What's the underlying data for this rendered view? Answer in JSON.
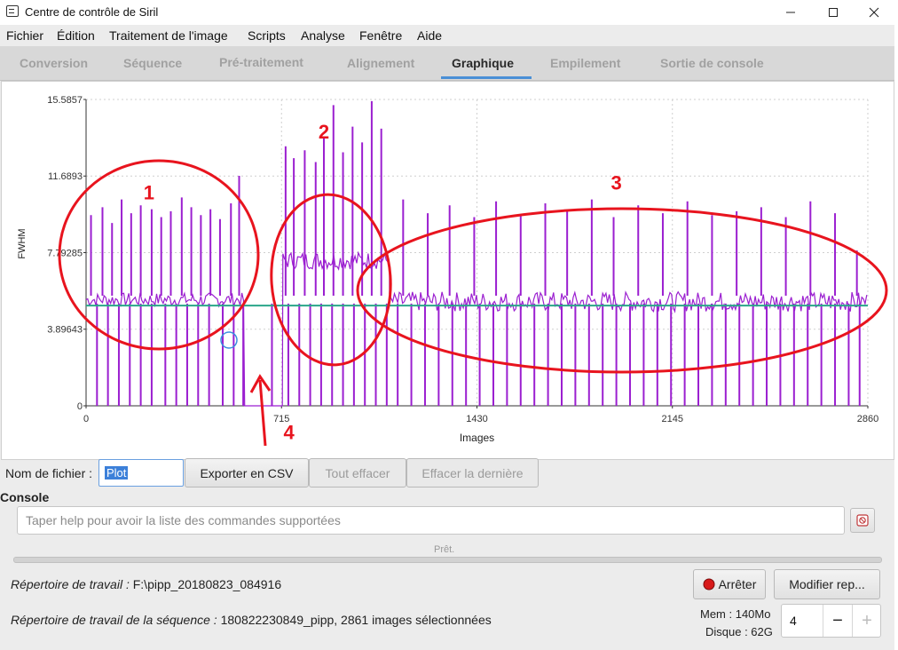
{
  "window": {
    "title": "Centre de contrôle de Siril",
    "app_icon": "siril-icon",
    "minimize_icon": "minimize-icon",
    "maximize_icon": "maximize-icon",
    "close_icon": "close-icon"
  },
  "menu": {
    "items": [
      {
        "label": "Fichier"
      },
      {
        "label": "Édition"
      },
      {
        "label": "Traitement de l'image"
      },
      {
        "label": "Scripts"
      },
      {
        "label": "Analyse"
      },
      {
        "label": "Fenêtre"
      },
      {
        "label": "Aide"
      }
    ]
  },
  "tabs": {
    "items": [
      {
        "label": "Conversion",
        "active": false
      },
      {
        "label": "Séquence",
        "active": false
      },
      {
        "label": "Pré-traitement",
        "active": false
      },
      {
        "label": "Alignement",
        "active": false
      },
      {
        "label": "Graphique",
        "active": true
      },
      {
        "label": "Empilement",
        "active": false
      },
      {
        "label": "Sortie de console",
        "active": false
      }
    ],
    "accent_color": "#4a8fd6"
  },
  "chart_data": {
    "type": "line",
    "title": "",
    "xlabel": "Images",
    "ylabel": "FWHM",
    "xlim": [
      0,
      2860
    ],
    "ylim": [
      0,
      15.5857
    ],
    "x_ticks": [
      "0",
      "715",
      "1430",
      "2145",
      "2860"
    ],
    "y_ticks": [
      "0",
      "3.89643",
      "7.79285",
      "11.6893",
      "15.5857"
    ],
    "grid": true,
    "series": [
      {
        "color": "#9b1fd0",
        "segments": [
          {
            "x_range": [
              0,
              580
            ],
            "base": 5.4,
            "noise": 0.35
          },
          {
            "x_range": [
              580,
              720
            ],
            "base": 0.0,
            "noise": 0.0
          },
          {
            "x_range": [
              720,
              1110
            ],
            "base": 7.4,
            "noise": 0.45
          },
          {
            "x_range": [
              1110,
              2860
            ],
            "base": 5.3,
            "noise": 0.5
          }
        ],
        "spikes_up": [
          {
            "x": 18,
            "y": 9.7
          },
          {
            "x": 60,
            "y": 10.1
          },
          {
            "x": 95,
            "y": 9.3
          },
          {
            "x": 130,
            "y": 10.5
          },
          {
            "x": 165,
            "y": 9.8
          },
          {
            "x": 200,
            "y": 10.2
          },
          {
            "x": 240,
            "y": 10.0
          },
          {
            "x": 275,
            "y": 9.6
          },
          {
            "x": 310,
            "y": 9.9
          },
          {
            "x": 350,
            "y": 10.6
          },
          {
            "x": 385,
            "y": 10.1
          },
          {
            "x": 420,
            "y": 9.7
          },
          {
            "x": 455,
            "y": 10.0
          },
          {
            "x": 490,
            "y": 9.5
          },
          {
            "x": 530,
            "y": 10.3
          },
          {
            "x": 560,
            "y": 11.7
          },
          {
            "x": 730,
            "y": 13.2
          },
          {
            "x": 760,
            "y": 12.6
          },
          {
            "x": 800,
            "y": 13.0
          },
          {
            "x": 840,
            "y": 12.4
          },
          {
            "x": 870,
            "y": 13.6
          },
          {
            "x": 905,
            "y": 15.3
          },
          {
            "x": 940,
            "y": 12.9
          },
          {
            "x": 975,
            "y": 14.2
          },
          {
            "x": 1010,
            "y": 13.4
          },
          {
            "x": 1045,
            "y": 15.5
          },
          {
            "x": 1080,
            "y": 14.1
          },
          {
            "x": 1160,
            "y": 10.5
          },
          {
            "x": 1250,
            "y": 9.8
          },
          {
            "x": 1330,
            "y": 10.2
          },
          {
            "x": 1420,
            "y": 9.6
          },
          {
            "x": 1500,
            "y": 10.4
          },
          {
            "x": 1590,
            "y": 9.7
          },
          {
            "x": 1680,
            "y": 10.3
          },
          {
            "x": 1760,
            "y": 9.9
          },
          {
            "x": 1850,
            "y": 10.5
          },
          {
            "x": 1930,
            "y": 9.6
          },
          {
            "x": 2020,
            "y": 10.2
          },
          {
            "x": 2110,
            "y": 9.8
          },
          {
            "x": 2200,
            "y": 10.4
          },
          {
            "x": 2290,
            "y": 9.7
          },
          {
            "x": 2380,
            "y": 9.9
          },
          {
            "x": 2470,
            "y": 10.1
          },
          {
            "x": 2560,
            "y": 9.6
          },
          {
            "x": 2650,
            "y": 10.4
          },
          {
            "x": 2740,
            "y": 9.8
          },
          {
            "x": 2820,
            "y": 7.9
          }
        ],
        "drops_to_zero": [
          40,
          80,
          120,
          160,
          200,
          240,
          290,
          330,
          370,
          410,
          450,
          500,
          540,
          575,
          680,
          740,
          780,
          820,
          860,
          900,
          940,
          980,
          1020,
          1060,
          1100,
          1140,
          1190,
          1240,
          1290,
          1340,
          1390,
          1440,
          1490,
          1540,
          1590,
          1640,
          1690,
          1740,
          1790,
          1840,
          1890,
          1940,
          1990,
          2040,
          2090,
          2140,
          2190,
          2240,
          2290,
          2340,
          2390,
          2440,
          2490,
          2540,
          2590,
          2640,
          2690,
          2740,
          2790,
          2830
        ]
      },
      {
        "color": "#2aa68a",
        "x": [
          0,
          2860
        ],
        "y": [
          5.1,
          5.1
        ]
      }
    ],
    "annotations": [
      {
        "text": "1",
        "x": 230,
        "y": 10.5
      },
      {
        "text": "2",
        "x": 870,
        "y": 13.6
      },
      {
        "text": "3",
        "x": 1940,
        "y": 11.0
      },
      {
        "text": "4",
        "x": 742,
        "y": -1.7
      }
    ]
  },
  "controls": {
    "filename_label": "Nom de fichier :",
    "filename_value": "Plot",
    "export_button": "Exporter en CSV",
    "clear_all_button": "Tout effacer",
    "clear_last_button": "Effacer la dernière"
  },
  "console": {
    "label": "Console",
    "placeholder": "Taper help pour avoir la liste des commandes supportées",
    "clear_icon": "clear-console-icon",
    "status": "Prêt."
  },
  "info": {
    "workdir_label": "Répertoire de travail :",
    "workdir_value": " F:\\pipp_20180823_084916",
    "seqdir_label": "Répertoire de travail de la séquence :",
    "seqdir_value": " 180822230849_pipp, 2861 images sélectionnées",
    "stop_button": "Arrêter",
    "modify_button": "Modifier rep...",
    "mem": "Mem : 140Mo",
    "disk": "Disque : 62G",
    "threads": "4",
    "minus": "−",
    "plus": "+"
  }
}
